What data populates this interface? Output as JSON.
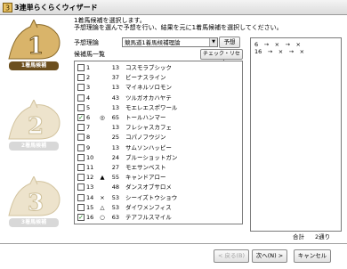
{
  "window": {
    "title": "3連単らくらくウィザード"
  },
  "steps": [
    {
      "number": "1",
      "label": "1着馬候補",
      "state": "active"
    },
    {
      "number": "2",
      "label": "2着馬候補",
      "state": "inactive"
    },
    {
      "number": "3",
      "label": "3着馬候補",
      "state": "inactive"
    }
  ],
  "instruction": {
    "line1": "1着馬候補を選択します。",
    "line2": "予想理論を選んで予想を行い、結果を元に1着馬候補を選択してください。"
  },
  "yoso": {
    "label": "予想理論",
    "selected": "競馬道1着馬候補理論",
    "button": "予想"
  },
  "list": {
    "label": "候補馬一覧",
    "check_reset_button": "チェック・リセット",
    "rows": [
      {
        "checked": false,
        "num": "1",
        "mark": "",
        "odds": "13",
        "name": "コスモラブシック"
      },
      {
        "checked": false,
        "num": "2",
        "mark": "",
        "odds": "37",
        "name": "ビーナスライン"
      },
      {
        "checked": false,
        "num": "3",
        "mark": "",
        "odds": "13",
        "name": "マイネルソロモン"
      },
      {
        "checked": false,
        "num": "4",
        "mark": "",
        "odds": "43",
        "name": "ツルガオカハヤテ"
      },
      {
        "checked": false,
        "num": "5",
        "mark": "",
        "odds": "13",
        "name": "モエレエスポワール"
      },
      {
        "checked": true,
        "num": "6",
        "mark": "◎",
        "odds": "65",
        "name": "トールハンマー"
      },
      {
        "checked": false,
        "num": "7",
        "mark": "",
        "odds": "13",
        "name": "フレシャスカフェ"
      },
      {
        "checked": false,
        "num": "8",
        "mark": "",
        "odds": "25",
        "name": "コパノフウジン"
      },
      {
        "checked": false,
        "num": "9",
        "mark": "",
        "odds": "13",
        "name": "サムソンハッピー"
      },
      {
        "checked": false,
        "num": "10",
        "mark": "",
        "odds": "24",
        "name": "ブルーショットガン"
      },
      {
        "checked": false,
        "num": "11",
        "mark": "",
        "odds": "27",
        "name": "モエサンベスト"
      },
      {
        "checked": false,
        "num": "12",
        "mark": "▲",
        "odds": "55",
        "name": "キャンドアロー"
      },
      {
        "checked": false,
        "num": "13",
        "mark": "",
        "odds": "48",
        "name": "ダンスオブサロメ"
      },
      {
        "checked": false,
        "num": "14",
        "mark": "×",
        "odds": "53",
        "name": "シーイズトウショウ"
      },
      {
        "checked": false,
        "num": "15",
        "mark": "△",
        "odds": "53",
        "name": "ダイワメンフィス"
      },
      {
        "checked": true,
        "num": "16",
        "mark": "○",
        "odds": "63",
        "name": "テアフルスマイル"
      }
    ]
  },
  "result": {
    "lines": [
      "6　→　×　→　×",
      "16　→　×　→　×"
    ],
    "total_label": "合計",
    "total_value": "2通り"
  },
  "buttons": {
    "back": "< 戻る(B)",
    "next": "次へ(N) >",
    "cancel": "キャンセル"
  },
  "colors": {
    "step_active": "#6c4f1e",
    "step_inactive": "#d8d8d8",
    "check_mark": "#1a8f1a"
  }
}
